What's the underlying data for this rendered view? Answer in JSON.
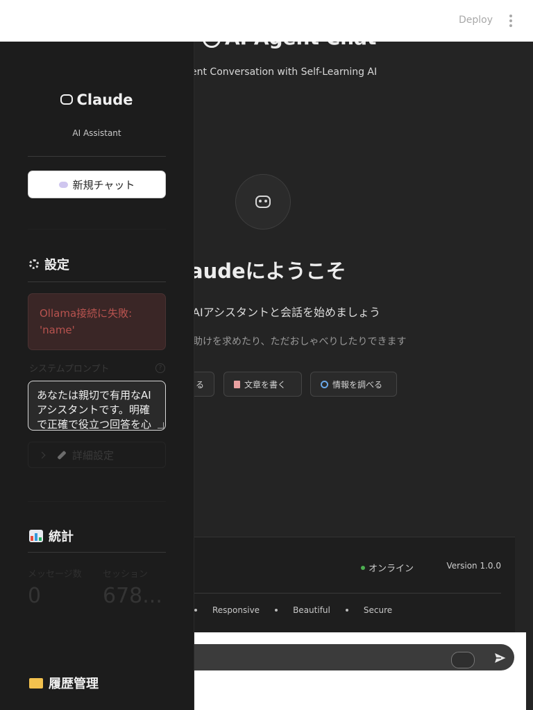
{
  "header": {
    "deploy_label": "Deploy",
    "menu_icon": "kebab-menu-icon"
  },
  "main": {
    "title": "AI Agent Chat",
    "subtitle": "ent Conversation with Self-Learning AI",
    "welcome": "audeにようこそ",
    "lead": "AIアシスタントと会話を始めましょう",
    "lead2": "助けを求めたり、ただおしゃべりしたりできます",
    "chips": [
      {
        "label": "る",
        "icon": ""
      },
      {
        "label": "文章を書く",
        "icon": "document-icon"
      },
      {
        "label": "情報を調べる",
        "icon": "search-icon"
      }
    ],
    "footer": {
      "status": "オンライン",
      "version": "Version 1.0.0",
      "tags": [
        "Responsive",
        "Beautiful",
        "Secure"
      ]
    },
    "input": {
      "placeholder": "."
    }
  },
  "sidebar": {
    "brand": "Claude",
    "tagline": "AI Assistant",
    "new_chat_label": "新規チャット",
    "settings": {
      "heading": "設定",
      "error": "Ollama接続に失敗: 'name'",
      "system_prompt_label": "システムプロンプト",
      "help_glyph": "?",
      "system_prompt_value": "あなたは親切で有用なAIアシスタントです。明確で正確で役立つ回答を心がけてください。",
      "advanced_label": "詳細設定"
    },
    "stats": {
      "heading": "統計",
      "messages_label": "メッセージ数",
      "messages_value": "0",
      "session_label": "セッション",
      "session_value": "678..."
    },
    "history": {
      "heading": "履歴管理"
    }
  },
  "colors": {
    "online": "#4caf50",
    "error_text": "#b8534f",
    "error_bg": "#3a2626"
  }
}
